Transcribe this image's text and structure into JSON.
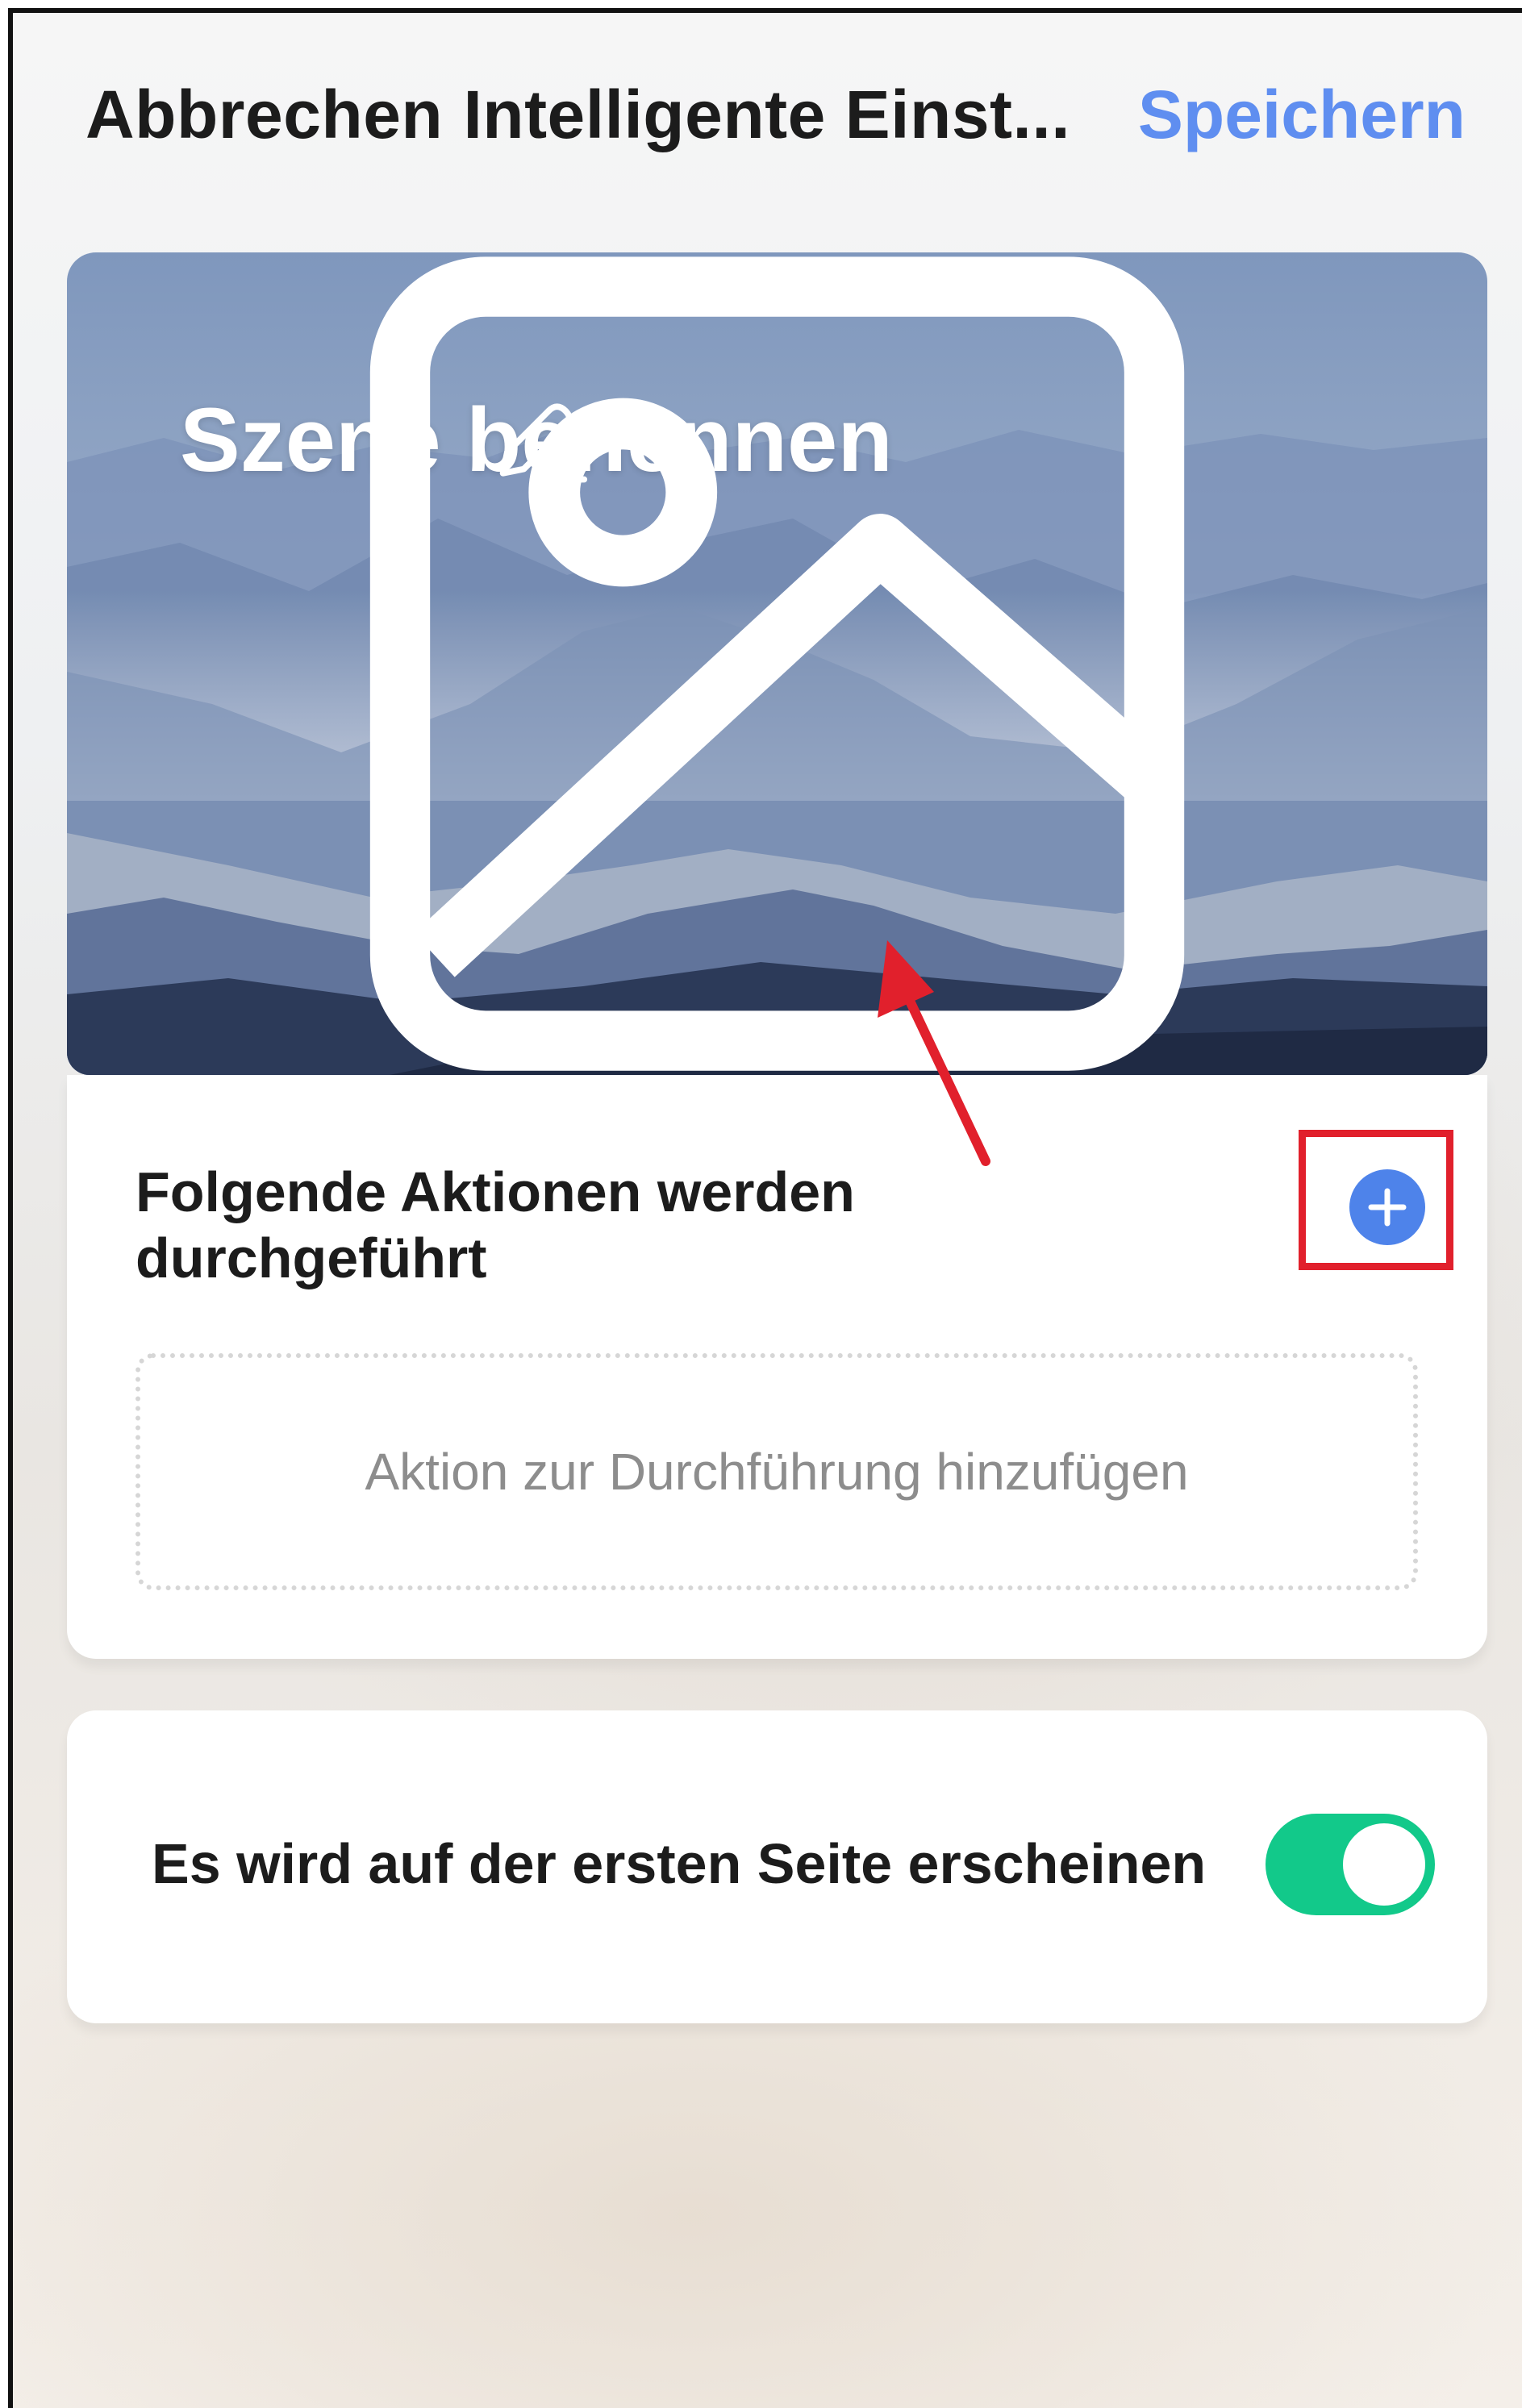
{
  "header": {
    "cancel_label": "Abbrechen",
    "title": "Intelligente Einst...",
    "save_label": "Speichern"
  },
  "scene": {
    "name_placeholder": "Szene benennen",
    "edit_icon": "pencil-icon",
    "image_icon": "image-icon"
  },
  "actions": {
    "title": "Folgende Aktionen werden durchgeführt",
    "add_icon": "plus-circle-icon",
    "add_placeholder": "Aktion zur Durchführung hinzufügen"
  },
  "settings": {
    "show_on_home_label": "Es wird auf der ersten Seite erscheinen",
    "show_on_home_enabled": true
  },
  "colors": {
    "accent": "#5f8ef0",
    "add_button": "#4e83ea",
    "toggle_on": "#12c98a",
    "annotation_red": "#e1202c"
  }
}
